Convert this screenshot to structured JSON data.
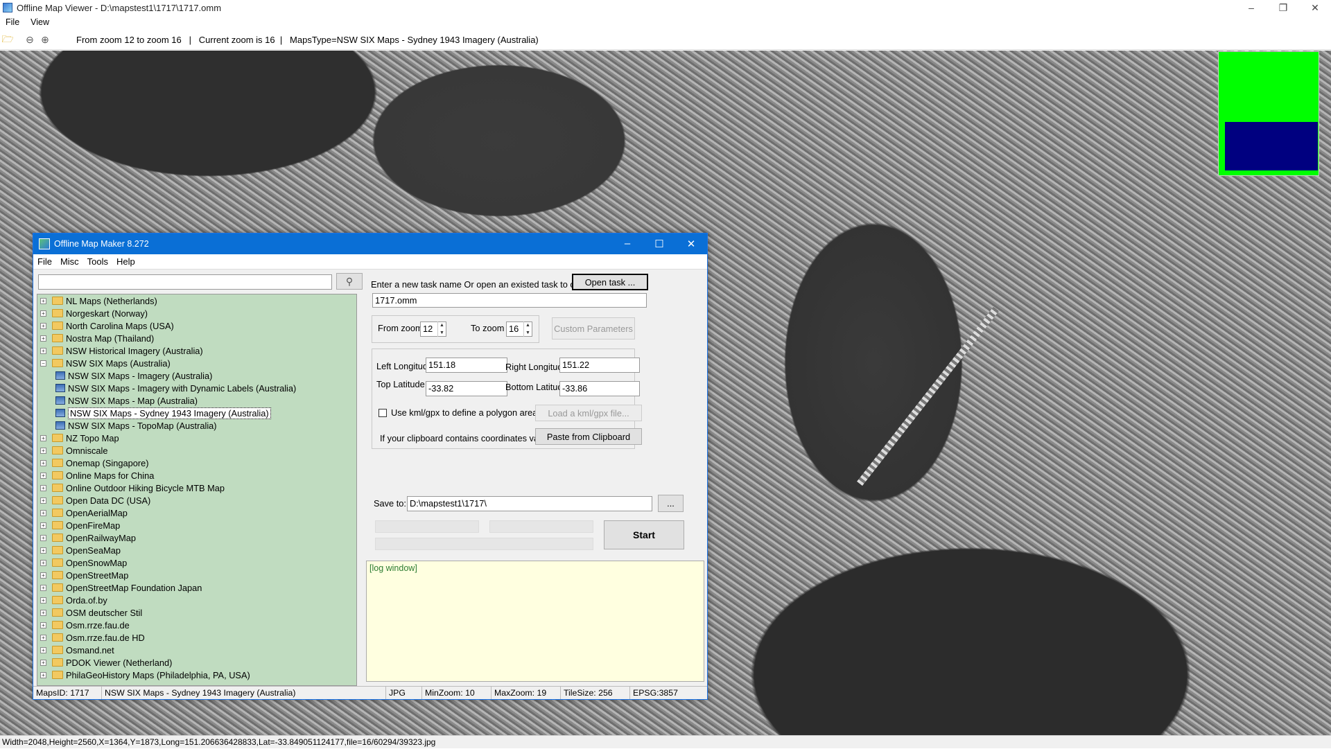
{
  "window": {
    "title": "Offline Map Viewer - D:\\mapstest1\\1717\\1717.omm",
    "controls": {
      "minimize": "–",
      "maximize": "❐",
      "close": "✕"
    }
  },
  "menubar": {
    "file": "File",
    "view": "View"
  },
  "toolbar": {
    "info": "From zoom 12 to zoom 16   |   Current zoom is 16  |   MapsType=NSW SIX Maps - Sydney 1943 Imagery (Australia)"
  },
  "statusbar": {
    "text": "Width=2048,Height=2560,X=1364,Y=1873,Long=151.206636428833,Lat=-33.849051124177,file=16/60294/39323.jpg"
  },
  "dialog": {
    "title": "Offline Map Maker 8.272",
    "controls": {
      "minimize": "–",
      "maximize": "☐",
      "close": "✕"
    },
    "menu": {
      "file": "File",
      "misc": "Misc",
      "tools": "Tools",
      "help": "Help"
    },
    "search": {
      "value": "",
      "button_icon": "search-icon"
    },
    "tree": [
      {
        "label": "NL Maps (Netherlands)",
        "type": "folder"
      },
      {
        "label": "Norgeskart (Norway)",
        "type": "folder"
      },
      {
        "label": "North Carolina Maps (USA)",
        "type": "folder"
      },
      {
        "label": "Nostra Map (Thailand)",
        "type": "folder"
      },
      {
        "label": "NSW Historical Imagery (Australia)",
        "type": "folder"
      },
      {
        "label": "NSW SIX Maps (Australia)",
        "type": "folder-open"
      },
      {
        "label": "NSW SIX Maps - Imagery (Australia)",
        "type": "leaf"
      },
      {
        "label": "NSW SIX Maps - Imagery with Dynamic Labels (Australia)",
        "type": "leaf"
      },
      {
        "label": "NSW SIX Maps - Map (Australia)",
        "type": "leaf"
      },
      {
        "label": "NSW SIX Maps - Sydney 1943 Imagery (Australia)",
        "type": "leaf",
        "selected": true
      },
      {
        "label": "NSW SIX Maps - TopoMap (Australia)",
        "type": "leaf"
      },
      {
        "label": "NZ Topo Map",
        "type": "folder"
      },
      {
        "label": "Omniscale",
        "type": "folder"
      },
      {
        "label": "Onemap (Singapore)",
        "type": "folder"
      },
      {
        "label": "Online Maps for China",
        "type": "folder"
      },
      {
        "label": "Online Outdoor Hiking Bicycle MTB Map",
        "type": "folder"
      },
      {
        "label": "Open Data DC (USA)",
        "type": "folder"
      },
      {
        "label": "OpenAerialMap",
        "type": "folder"
      },
      {
        "label": "OpenFireMap",
        "type": "folder"
      },
      {
        "label": "OpenRailwayMap",
        "type": "folder"
      },
      {
        "label": "OpenSeaMap",
        "type": "folder"
      },
      {
        "label": "OpenSnowMap",
        "type": "folder"
      },
      {
        "label": "OpenStreetMap",
        "type": "folder"
      },
      {
        "label": "OpenStreetMap Foundation Japan",
        "type": "folder"
      },
      {
        "label": "Orda.of.by",
        "type": "folder"
      },
      {
        "label": "OSM deutscher Stil",
        "type": "folder"
      },
      {
        "label": "Osm.rrze.fau.de",
        "type": "folder"
      },
      {
        "label": "Osm.rrze.fau.de HD",
        "type": "folder"
      },
      {
        "label": "Osmand.net",
        "type": "folder"
      },
      {
        "label": "PDOK Viewer (Netherland)",
        "type": "folder"
      },
      {
        "label": "PhilaGeoHistory Maps (Philadelphia, PA, USA)",
        "type": "folder"
      }
    ],
    "task": {
      "prompt": "Enter a new task name Or open an existed task to continue:",
      "open_button": "Open task ...",
      "name_value": "1717.omm"
    },
    "zoom": {
      "from_label": "From zoom",
      "from_value": "12",
      "to_label": "To zoom",
      "to_value": "16",
      "custom_button": "Custom Parameters"
    },
    "coords": {
      "left_lon_label": "Left Longitude",
      "left_lon": "151.18",
      "right_lon_label": "Right Longitude",
      "right_lon": "151.22",
      "top_lat_label": "Top Latitude",
      "top_lat": "-33.82",
      "bottom_lat_label": "Bottom Latitude",
      "bottom_lat": "-33.86",
      "kml_checkbox_label": "Use kml/gpx to define a polygon area",
      "kml_button": "Load a kml/gpx file...",
      "clipboard_label": "If your clipboard contains coordinates values:",
      "clipboard_button": "Paste from Clipboard"
    },
    "save": {
      "label": "Save to:",
      "value": "D:\\mapstest1\\1717\\",
      "browse": "..."
    },
    "start_button": "Start",
    "log": {
      "text": "[log window]"
    },
    "status": {
      "maps_id": "MapsID: 1717",
      "maps_name": "NSW SIX Maps - Sydney 1943 Imagery (Australia)",
      "format": "JPG",
      "min_zoom": "MinZoom: 10",
      "max_zoom": "MaxZoom: 19",
      "tile_size": "TileSize: 256",
      "epsg": "EPSG:3857"
    }
  },
  "colors": {
    "accent": "#0a6fd6",
    "tree_bg": "#c0dcc0",
    "log_bg": "#ffffe0",
    "minimap_bg": "#00ff00",
    "minimap_viewport": "#000080"
  }
}
